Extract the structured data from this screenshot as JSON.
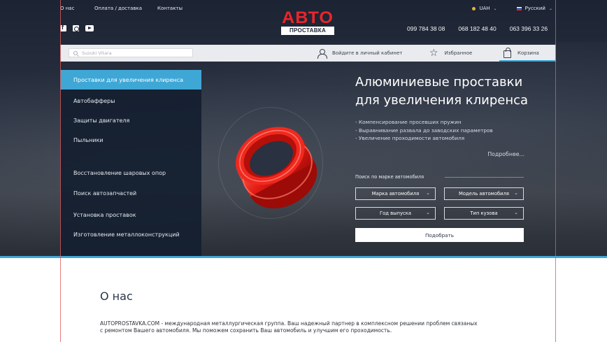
{
  "colors": {
    "accent": "#3fa7d6",
    "brand_red": "#e8262b",
    "header_bg": "#1c2333",
    "sidebar_bg": "#141e30"
  },
  "topnav": {
    "items": [
      "О нас",
      "Оплата / доставка",
      "Контакты"
    ]
  },
  "topright": {
    "currency": "UAH",
    "language": "Русский"
  },
  "socials": [
    "facebook-icon",
    "instagram-icon",
    "youtube-icon"
  ],
  "logo": {
    "top": "АВТО",
    "bottom": "ПРОСТАВКА"
  },
  "phones": [
    "099 784 38 08",
    "068 182 48 40",
    "063 396 33 26"
  ],
  "bar": {
    "search_placeholder": "Suzuki Vitara",
    "login_label": "Войдите в личный кабинет",
    "favorites_label": "Избранное",
    "cart_label": "Корзина"
  },
  "sidebar": {
    "items": [
      "Проставки для увеличения клиренса",
      "Автобафферы",
      "Защиты двигателя",
      "Пыльники",
      "Восстановление шаровых опор",
      "Поиск автозапчастей",
      "Установка проставок",
      "Изготовление металлоконструкций"
    ],
    "active_index": 0
  },
  "hero": {
    "title_line1": "Алюминиевые проставки",
    "title_line2": "для увеличения клиренса",
    "bullets": [
      "- Компенсирование просевших пружин",
      "- Выравнивание развала до заводских параметров",
      "- Увеличение проходимости  автомобиля"
    ],
    "more_link": "Подробнее...",
    "search_label": "Поиск  по марке автомобиля",
    "selects": {
      "brand": "Марка автомобиля",
      "model": "Модель автомобиля",
      "year": "Год выпуска",
      "body": "Тип кузова"
    },
    "pick_button": "Подобрать"
  },
  "about": {
    "title": "О нас",
    "text_line1": "AUTOPROSTAVKA.COM - международная металлургическая группа. Ваш надежный партнер в комплексном решении проблем связаных",
    "text_line2": "с ремонтом  Вашего автомобиля. Мы поможем сохранить Ваш автомобиль и улучшим его проходимость."
  }
}
